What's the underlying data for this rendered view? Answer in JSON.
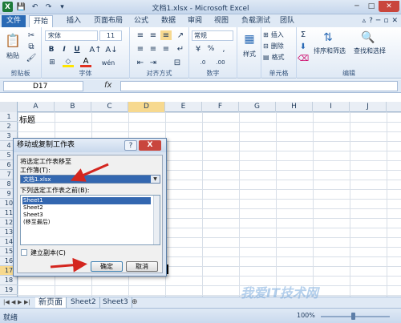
{
  "window": {
    "title": "文档1.xlsx - Microsoft Excel"
  },
  "ribbon_tabs": [
    "文件",
    "开始",
    "插入",
    "页面布局",
    "公式",
    "数据",
    "审阅",
    "视图",
    "负载测试",
    "团队"
  ],
  "clipboard": {
    "paste": "粘贴",
    "label": "剪贴板"
  },
  "font": {
    "name": "宋体",
    "size": "11",
    "label": "字体",
    "bold": "B",
    "italic": "I",
    "underline": "U",
    "wen": "wén",
    "A": "A"
  },
  "alignment": {
    "label": "对齐方式"
  },
  "number": {
    "format": "常规",
    "label": "数字",
    "percent": "%",
    "comma": ",",
    "inc": ".0",
    "dec": ".00"
  },
  "styles": {
    "label": "样式"
  },
  "cells": {
    "insert": "插入",
    "delete": "删除",
    "format": "格式",
    "label": "单元格"
  },
  "editing": {
    "sigma": "Σ",
    "sort": "排序和筛选",
    "find": "查找和选择",
    "label": "编辑"
  },
  "formula_bar": {
    "name_box": "D17",
    "fx": "fx"
  },
  "columns": [
    "A",
    "B",
    "C",
    "D",
    "E",
    "F",
    "G",
    "H",
    "I",
    "J"
  ],
  "rows": [
    "1",
    "2",
    "3",
    "4",
    "5",
    "6",
    "7",
    "8",
    "9",
    "10",
    "11",
    "12",
    "13",
    "14",
    "15",
    "16",
    "17",
    "18",
    "19"
  ],
  "cell_A1": "标题",
  "dialog": {
    "title": "移动或复制工作表",
    "help": "?",
    "close": "X",
    "move_to_label": "将选定工作表移至",
    "workbook_label": "工作簿(T):",
    "workbook_value": "文档1.xlsx",
    "before_label": "下列选定工作表之前(B):",
    "sheets": [
      "Sheet1",
      "Sheet2",
      "Sheet3",
      "(移至最后)"
    ],
    "copy_label": "建立副本(C)",
    "ok": "确定",
    "cancel": "取消"
  },
  "sheet_tabs": [
    "新页面",
    "Sheet2",
    "Sheet3"
  ],
  "status": {
    "ready": "就绪",
    "zoom": "100%"
  },
  "watermark": "我爱IT技术网"
}
